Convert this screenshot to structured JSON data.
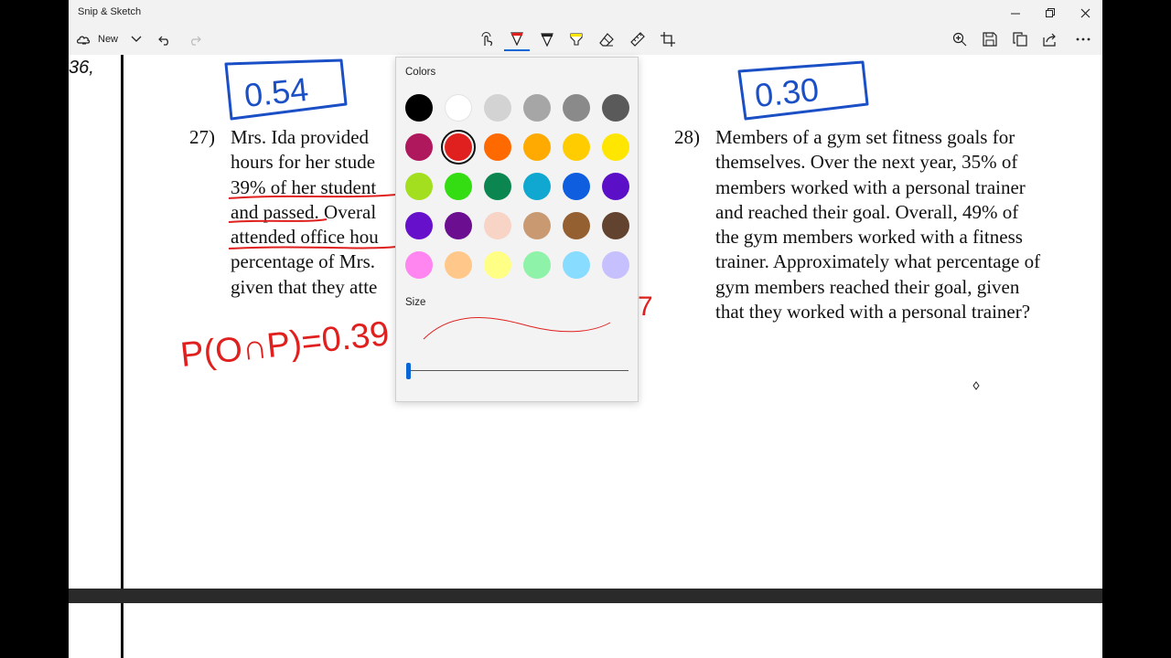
{
  "window": {
    "title": "Snip & Sketch",
    "controls": {
      "minimize_icon": "minimize-icon",
      "maximize_icon": "restore-icon",
      "close_icon": "close-icon"
    }
  },
  "toolbar": {
    "new_label": "New",
    "left_tools": [
      "new-snip-icon",
      "chevron-down-icon",
      "undo-icon",
      "redo-icon"
    ],
    "center_tools": [
      "touch-writing-icon",
      "ballpoint-pen-icon",
      "pencil-icon",
      "highlighter-icon",
      "eraser-icon",
      "ruler-icon",
      "crop-icon"
    ],
    "right_tools": [
      "zoom-icon",
      "save-icon",
      "copy-icon",
      "share-icon",
      "more-icon"
    ],
    "active_tool": "ballpoint-pen",
    "pen_color": "#e0201e"
  },
  "document": {
    "left_answer": "0.54",
    "right_answer": "0.30",
    "q27": {
      "number": "27)",
      "lines": [
        "Mrs. Ida provided",
        "hours for her stude",
        "39% of her student",
        "and passed. Overal",
        "attended office hou",
        "percentage of Mrs.",
        "given that they atte"
      ]
    },
    "q28": {
      "number": "28)",
      "lines": [
        "Members of a gym set fitness goals for",
        "themselves. Over the next year, 35% of",
        "members worked with a personal trainer",
        "and reached their goal. Overall, 49% of",
        "the gym members worked with a fitness",
        "trainer. Approximately what percentage of",
        "gym members reached their goal, given",
        "that they worked with a personal trainer?"
      ]
    },
    "handwritten_formula": "P(O∩P)=0.39",
    "handwritten_partial": "7",
    "corner_scribble": "36,"
  },
  "color_picker": {
    "colors_label": "Colors",
    "size_label": "Size",
    "selected_color": "#e0201e",
    "size_value": 0,
    "swatches": [
      "#000000",
      "#ffffff",
      "#d3d3d3",
      "#a6a6a6",
      "#8a8a8a",
      "#5a5a5a",
      "#b0185e",
      "#e0201e",
      "#ff6a00",
      "#ffaa00",
      "#ffcc00",
      "#ffe600",
      "#a3df1f",
      "#33dd11",
      "#0b8650",
      "#10a8d0",
      "#0f5ee0",
      "#5b10c8",
      "#6610cc",
      "#6b0e8f",
      "#f7d4c5",
      "#c99a72",
      "#946032",
      "#62432f",
      "#ff85f0",
      "#ffc88a",
      "#ffff85",
      "#8ef2a8",
      "#87dcff",
      "#c7c0ff"
    ]
  }
}
